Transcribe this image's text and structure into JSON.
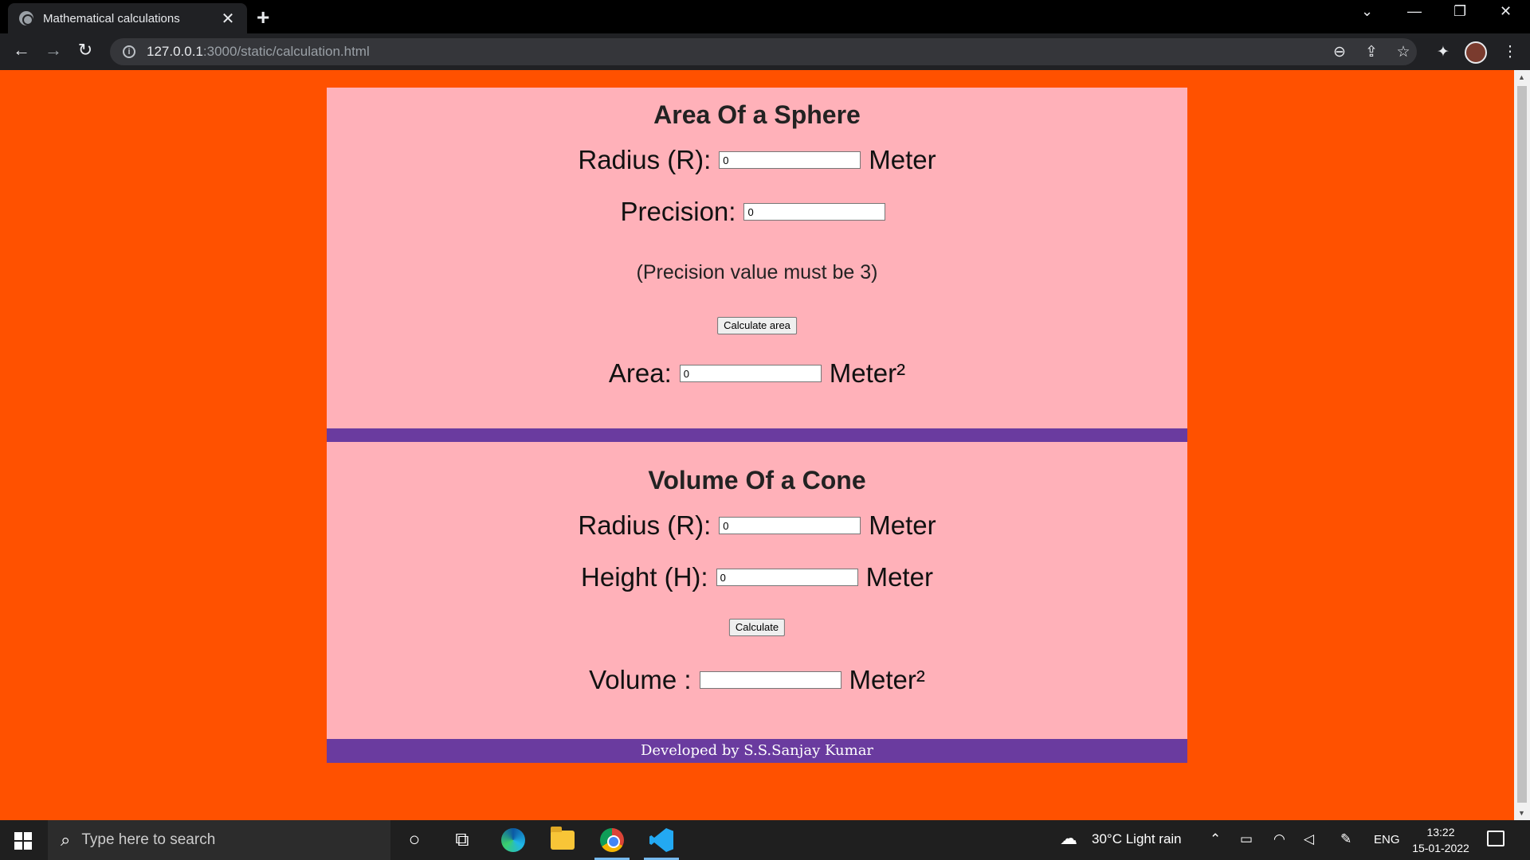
{
  "browser": {
    "tab_title": "Mathematical calculations",
    "tab_close": "✕",
    "new_tab": "+",
    "url_host": "127.0.0.1",
    "url_path": ":3000/static/calculation.html",
    "window_controls": {
      "tabsearch": "⌄",
      "minimize": "—",
      "restore": "❐",
      "close": "✕"
    },
    "nav": {
      "back": "←",
      "forward": "→",
      "reload": "↻"
    },
    "toolbar_icons": {
      "zoom": "⊖",
      "share": "⇪",
      "bookmark": "☆",
      "extensions": "✦",
      "menu": "⋮"
    }
  },
  "sphere": {
    "title": "Area Of a Sphere",
    "radius_label": "Radius (R):",
    "radius_value": "0",
    "radius_unit": "Meter",
    "precision_label": "Precision:",
    "precision_value": "0",
    "note": "(Precision value must be 3)",
    "button": "Calculate area",
    "area_label": "Area:",
    "area_value": "0",
    "area_unit": "Meter²"
  },
  "cone": {
    "title": "Volume Of a Cone",
    "radius_label": "Radius (R):",
    "radius_value": "0",
    "radius_unit": "Meter",
    "height_label": "Height (H):",
    "height_value": "0",
    "height_unit": "Meter",
    "button": "Calculate",
    "volume_label": "Volume :",
    "volume_value": "",
    "volume_unit": "Meter²"
  },
  "footer": {
    "text": "Developed by S.S.Sanjay Kumar"
  },
  "taskbar": {
    "search_placeholder": "Type here to search",
    "weather": "30°C  Light rain",
    "language": "ENG",
    "time": "13:22",
    "date": "15-01-2022"
  },
  "colors": {
    "page_bg": "#ff5100",
    "panel_bg": "#ffb1b9",
    "accent_purple": "#6a3b9f"
  }
}
